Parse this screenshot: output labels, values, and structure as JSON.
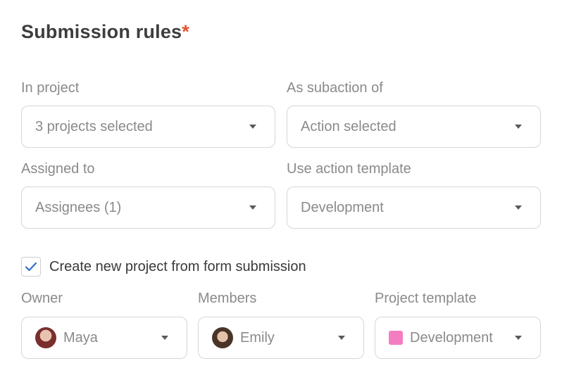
{
  "section": {
    "title": "Submission rules",
    "required_mark": "*"
  },
  "fields": {
    "in_project": {
      "label": "In project",
      "value": "3 projects selected"
    },
    "as_subaction_of": {
      "label": "As subaction of",
      "value": "Action selected"
    },
    "assigned_to": {
      "label": "Assigned to",
      "value": "Assignees (1)"
    },
    "use_action_template": {
      "label": "Use action template",
      "value": "Development"
    }
  },
  "create_project": {
    "checked": true,
    "label": "Create new project from form submission"
  },
  "project_fields": {
    "owner": {
      "label": "Owner",
      "value": "Maya",
      "icon": "avatar"
    },
    "members": {
      "label": "Members",
      "value": "Emily",
      "icon": "avatar"
    },
    "project_template": {
      "label": "Project template",
      "value": "Development",
      "swatch_color": "#f47cc1"
    }
  },
  "colors": {
    "required": "#e2542f",
    "check": "#2f6fd1"
  }
}
